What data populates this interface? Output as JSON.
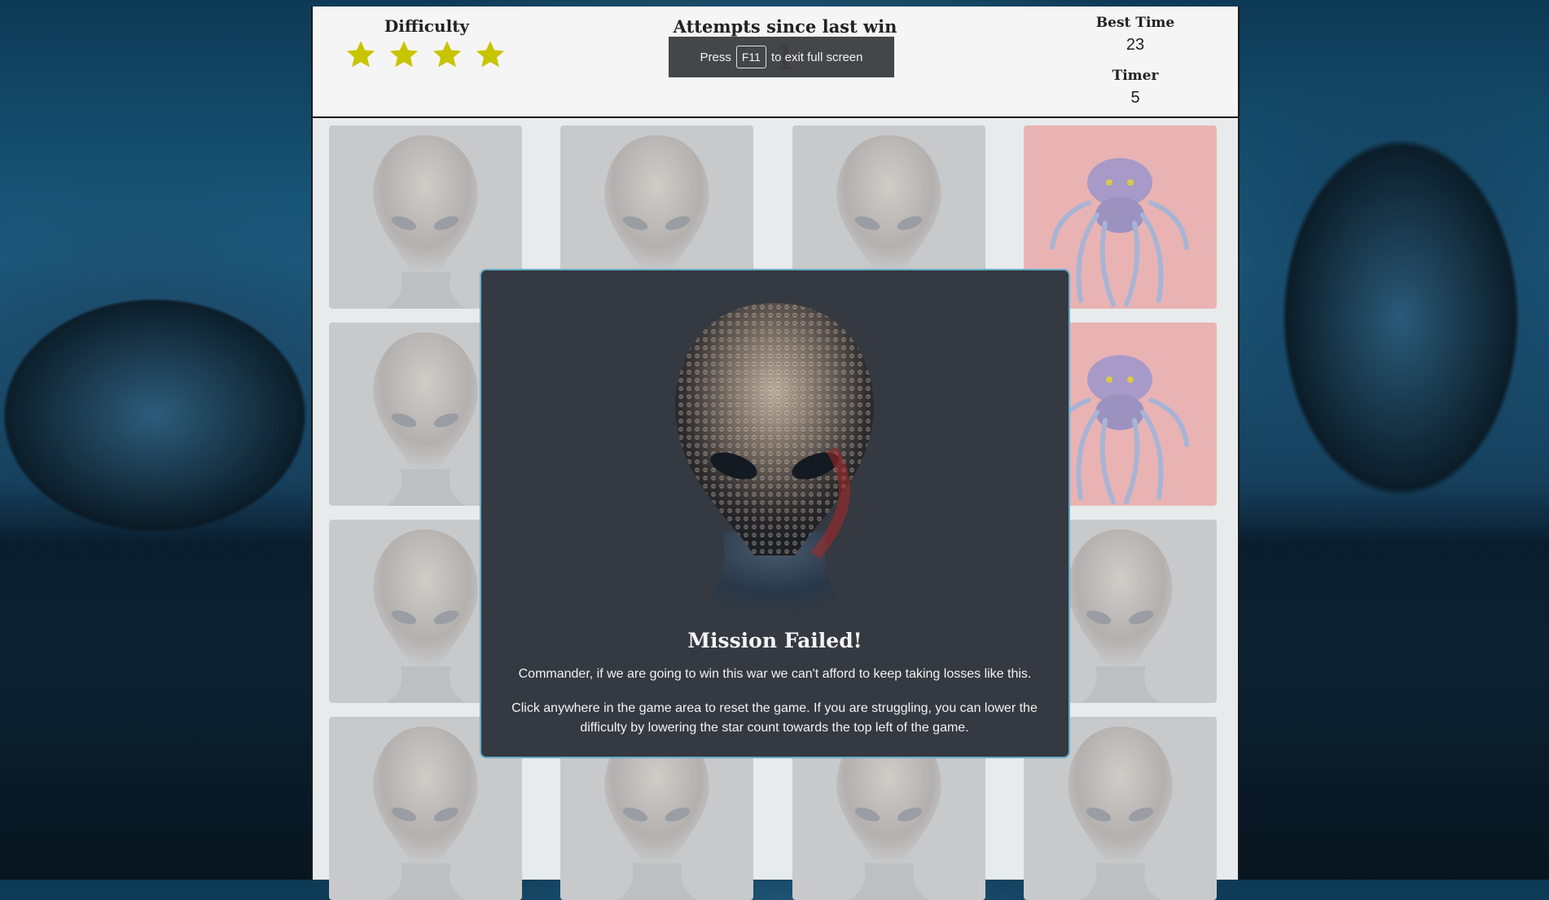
{
  "header": {
    "difficulty_title": "Difficulty",
    "difficulty_stars": 4,
    "attempts_title": "Attempts since last win",
    "attempts_value": "1",
    "best_time_label": "Best Time",
    "best_time_value": "23",
    "timer_label": "Timer",
    "timer_value": "5"
  },
  "fullscreen_notice": {
    "prefix": "Press",
    "key": "F11",
    "suffix": "to exit full screen"
  },
  "board": {
    "cards": [
      {
        "face": "sectoid"
      },
      {
        "face": "sectoid"
      },
      {
        "face": "sectoid"
      },
      {
        "face": "chryssalid",
        "state": "revealed"
      },
      {
        "face": "sectoid"
      },
      {
        "face": "sectoid"
      },
      {
        "face": "sectoid"
      },
      {
        "face": "chryssalid",
        "state": "revealed"
      },
      {
        "face": "sectoid"
      },
      {
        "face": "sectoid"
      },
      {
        "face": "sectoid"
      },
      {
        "face": "sectoid"
      },
      {
        "face": "sectoid"
      },
      {
        "face": "sectoid"
      },
      {
        "face": "sectoid"
      },
      {
        "face": "sectoid"
      }
    ]
  },
  "modal": {
    "title": "Mission Failed!",
    "line1": "Commander, if we are going to win this war we can't afford to keep taking losses like this.",
    "line2": "Click anywhere in the game area to reset the game. If you are struggling, you can lower the difficulty by lowering the star count towards the top left of the game.",
    "art": "alien-head-icon"
  },
  "colors": {
    "star": "#c9c400",
    "modal_bg": "#353941",
    "modal_border": "#68aecb",
    "card_back": "#c8c9cb",
    "card_revealed": "#e9b3b3",
    "attempts": "#8b1a1a"
  }
}
